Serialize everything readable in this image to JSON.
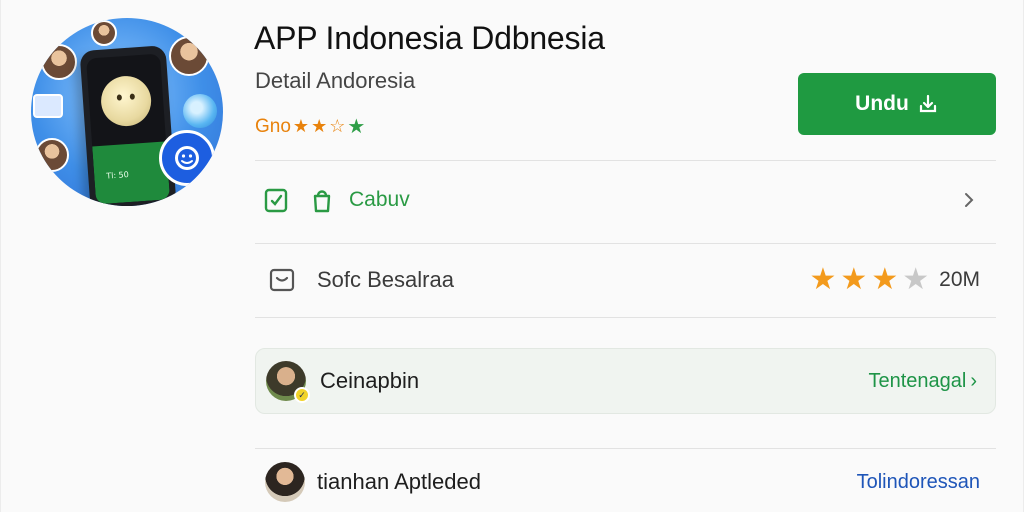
{
  "app": {
    "title": "APP Indonesia Ddbnesia",
    "subtitle": "Detail Andoresia",
    "rating_text": "Gno",
    "rating_stars": 3,
    "install_label": "Undu",
    "phone_text": "Tl: 50"
  },
  "category": {
    "label": "Cabuv"
  },
  "info": {
    "label": "Sofc Besalraa",
    "stars": 3,
    "max_stars": 4,
    "size": "20M"
  },
  "developer": {
    "name": "Ceinapbin",
    "link": "Tentenagal"
  },
  "bottom": {
    "name": "tianhan Aptleded",
    "link": "Tolindoressan"
  },
  "colors": {
    "accent_green": "#1f9a41",
    "rating_orange": "#e8820c",
    "link_blue": "#1e55b8"
  },
  "icons": {
    "install": "download-icon",
    "category_a": "tablet-icon",
    "category_b": "shopping-bag-icon",
    "info": "rating-card-icon",
    "chevron": "chevron-right-icon"
  }
}
